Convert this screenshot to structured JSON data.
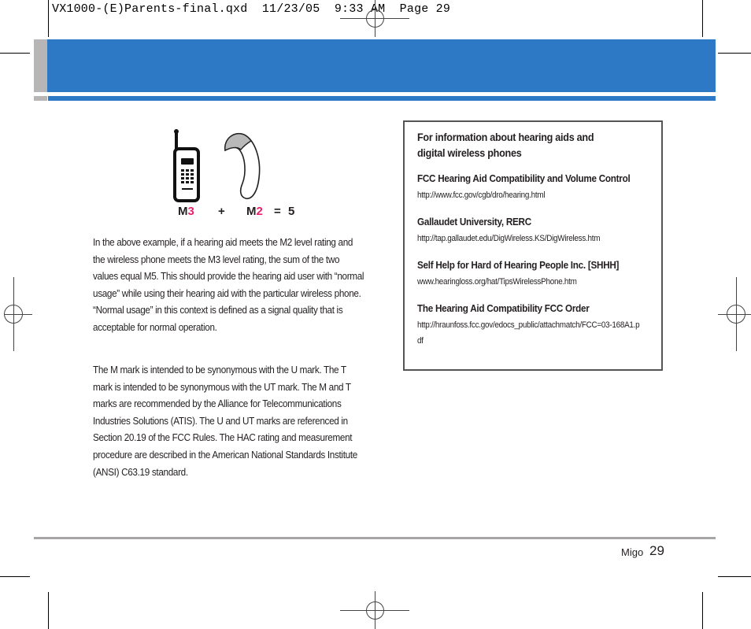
{
  "slug": {
    "filename": "VX1000-(E)Parents-final.qxd",
    "date": "11/23/05",
    "time": "9:33 AM",
    "page_label": "Page 29",
    "text": "VX1000-(E)Parents-final.qxd  11/23/05  9:33 AM  Page 29"
  },
  "colors": {
    "header_blue": "#2e79c6",
    "header_gray": "#b8b5b6",
    "rating_pink": "#e8226f",
    "footer_rule": "#a7a5a6",
    "box_border": "#555555"
  },
  "figure": {
    "phone_icon": "cell-phone-icon",
    "hearing_aid_icon": "hearing-aid-icon",
    "phone_rating_letter": "M",
    "phone_rating_number": "3",
    "plus": "+",
    "aid_rating_letter": "M",
    "aid_rating_number": "2",
    "equals": "=",
    "sum": "5"
  },
  "body": {
    "paragraphs": [
      "In the above example, if a hearing aid meets the M2 level rating and the wireless phone meets the M3 level rating, the sum of the two values equal M5. This should provide the hearing aid user with “normal usage” while using their hearing aid with the particular wireless phone. “Normal usage” in this context is defined as a signal quality that is acceptable for normal operation.",
      "The M mark is intended to be synonymous with the U mark. The T mark is intended to be synonymous with the UT mark. The M and T marks are recommended by the Alliance for Telecommunications Industries Solutions (ATIS). The U and UT marks are referenced in Section 20.19 of the FCC Rules. The HAC rating and measurement procedure are described in the American National Standards Institute (ANSI) C63.19 standard."
    ]
  },
  "infobox": {
    "title": "For information about hearing aids and digital wireless phones",
    "title_line1": "For information about hearing aids and",
    "title_line2": "digital wireless phones",
    "entries": [
      {
        "name": "FCC Hearing Aid Compatibility and Volume Control",
        "url": "http://www.fcc.gov/cgb/dro/hearing.html"
      },
      {
        "name": "Gallaudet University, RERC",
        "url": "http://tap.gallaudet.edu/DigWireless.KS/DigWireless.htm"
      },
      {
        "name": "Self Help for Hard of Hearing People Inc. [SHHH]",
        "url": "www.hearingloss.org/hat/TipsWirelessPhone.htm"
      },
      {
        "name": "The Hearing Aid Compatibility FCC Order",
        "url": "http://hraunfoss.fcc.gov/edocs_public/attachmatch/FCC=03-168A1.pdf"
      }
    ]
  },
  "footer": {
    "product": "Migo",
    "page_number": "29"
  }
}
